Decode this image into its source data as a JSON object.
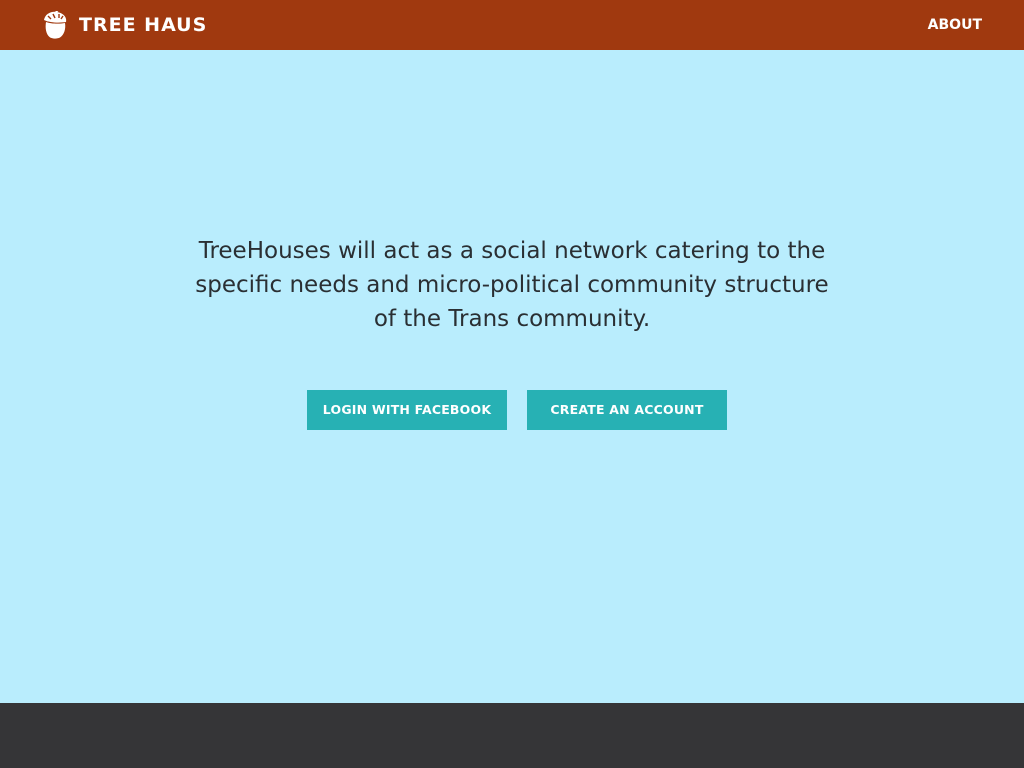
{
  "header": {
    "brand_name": "TREE HAUS",
    "brand_icon": "acorn-icon",
    "nav": {
      "about_label": "ABOUT"
    }
  },
  "hero": {
    "tagline": "TreeHouses will act as a social network catering to the specific needs and micro-political community structure of the Trans community.",
    "buttons": {
      "facebook_label": "LOGIN WITH FACEBOOK",
      "create_label": "CREATE AN ACCOUNT"
    }
  },
  "colors": {
    "header_background": "#a0390f",
    "page_background": "#b9edfd",
    "button_background": "#27b1b4",
    "footer_background": "#353537",
    "text": "#2a2f33"
  }
}
